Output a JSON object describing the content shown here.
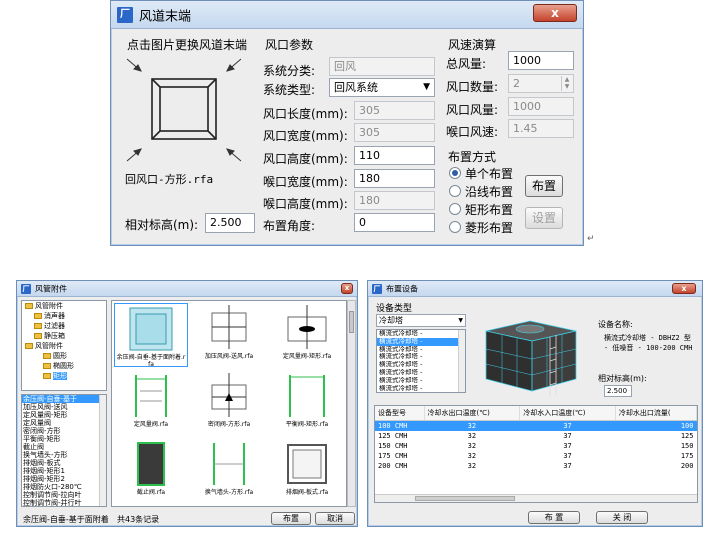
{
  "dlg1": {
    "title": "风道末端",
    "close": "x",
    "preview_hint": "点击图片更换风道末端",
    "preview_name": "回风口-方形.rfa",
    "rel_height_label": "相对标高(m):",
    "rel_height_value": "2.500",
    "params": {
      "group": "风口参数",
      "sys_class_label": "系统分类:",
      "sys_class_value": "回风",
      "sys_type_label": "系统类型:",
      "sys_type_value": "回风系统",
      "length_label": "风口长度(mm):",
      "length_value": "305",
      "width_label": "风口宽度(mm):",
      "width_value": "305",
      "height_label": "风口高度(mm):",
      "height_value": "110",
      "throat_w_label": "喉口宽度(mm):",
      "throat_w_value": "180",
      "throat_h_label": "喉口高度(mm):",
      "throat_h_value": "180",
      "angle_label": "布置角度:",
      "angle_value": "0"
    },
    "speed": {
      "group": "风速演算",
      "total_label": "总风量:",
      "total_value": "1000",
      "count_label": "风口数量:",
      "count_value": "2",
      "per_label": "风口风量:",
      "per_value": "1000",
      "throat_label": "喉口风速:",
      "throat_value": "1.45"
    },
    "layout": {
      "group": "布置方式",
      "opt1": "单个布置",
      "opt2": "沿线布置",
      "opt3": "矩形布置",
      "opt4": "菱形布置",
      "place_btn": "布置",
      "settings_btn": "设置",
      "selected": "单个布置"
    }
  },
  "dlg2": {
    "title": "风管附件",
    "tree": [
      {
        "label": "风管附件",
        "level": 0
      },
      {
        "label": "消声器",
        "level": 1
      },
      {
        "label": "过滤器",
        "level": 1
      },
      {
        "label": "静压箱",
        "level": 1
      },
      {
        "label": "风管附件",
        "level": 0
      },
      {
        "label": "圆形",
        "level": 2
      },
      {
        "label": "椭圆形",
        "level": 2
      },
      {
        "label": "矩形",
        "level": 2
      }
    ],
    "list": [
      "余压阀-自垂-基于",
      "加压风阀-送风",
      "定风量阀-矩形",
      "定风量阀",
      "密闭阀-方形",
      "平衡阀-矩形",
      "截止阀",
      "换气墙头-方形",
      "排烟阀-板式",
      "排烟阀-矩形1",
      "排烟阀-矩形2",
      "排烟防火口-280℃",
      "控制调节阀-拉向叶",
      "控制调节阀-并行叶"
    ],
    "thumbs": [
      "余压阀-自垂-基于面附着.rfa",
      "加压风阀-送风.rfa",
      "定风量阀-矩形.rfa",
      "定风量阀.rfa",
      "密闭阀-方形.rfa",
      "平衡阀-矩形.rfa",
      "截止阀.rfa",
      "换气墙头-方形.rfa",
      "排烟阀-板式.rfa"
    ],
    "status": "余压阀-自垂-基于面附着",
    "count": "共43条记录",
    "place_btn": "布置",
    "cancel_btn": "取消"
  },
  "dlg3": {
    "title": "布置设备",
    "close": "x",
    "type_group": "设备类型",
    "combo_value": "冷却塔",
    "list": [
      "横流式冷却塔 -",
      "横流式冷却塔 -",
      "横流式冷却塔 -",
      "横流式冷却塔 -",
      "横流式冷却塔 -",
      "横流式冷却塔 -",
      "横流式冷却塔 -",
      "横流式冷却塔 -"
    ],
    "name_label": "设备名称:",
    "name_value": "横流式冷却塔 - DBHZ2 型 - 低噪音 - 100-200 CMH",
    "rel_height_label": "相对标高(m):",
    "rel_height_value": "2.500",
    "table": {
      "headers": [
        "设备型号",
        "冷却水出口温度(℃)",
        "冷却水入口温度(℃)",
        "冷却水出口流量("
      ],
      "rows": [
        [
          "100 CMH",
          "32",
          "37",
          "100"
        ],
        [
          "125 CMH",
          "32",
          "37",
          "125"
        ],
        [
          "150 CMH",
          "32",
          "37",
          "150"
        ],
        [
          "175 CMH",
          "32",
          "37",
          "175"
        ],
        [
          "200 CMH",
          "32",
          "37",
          "200"
        ]
      ]
    },
    "place_btn": "布 置",
    "close_btn": "关 闭"
  }
}
